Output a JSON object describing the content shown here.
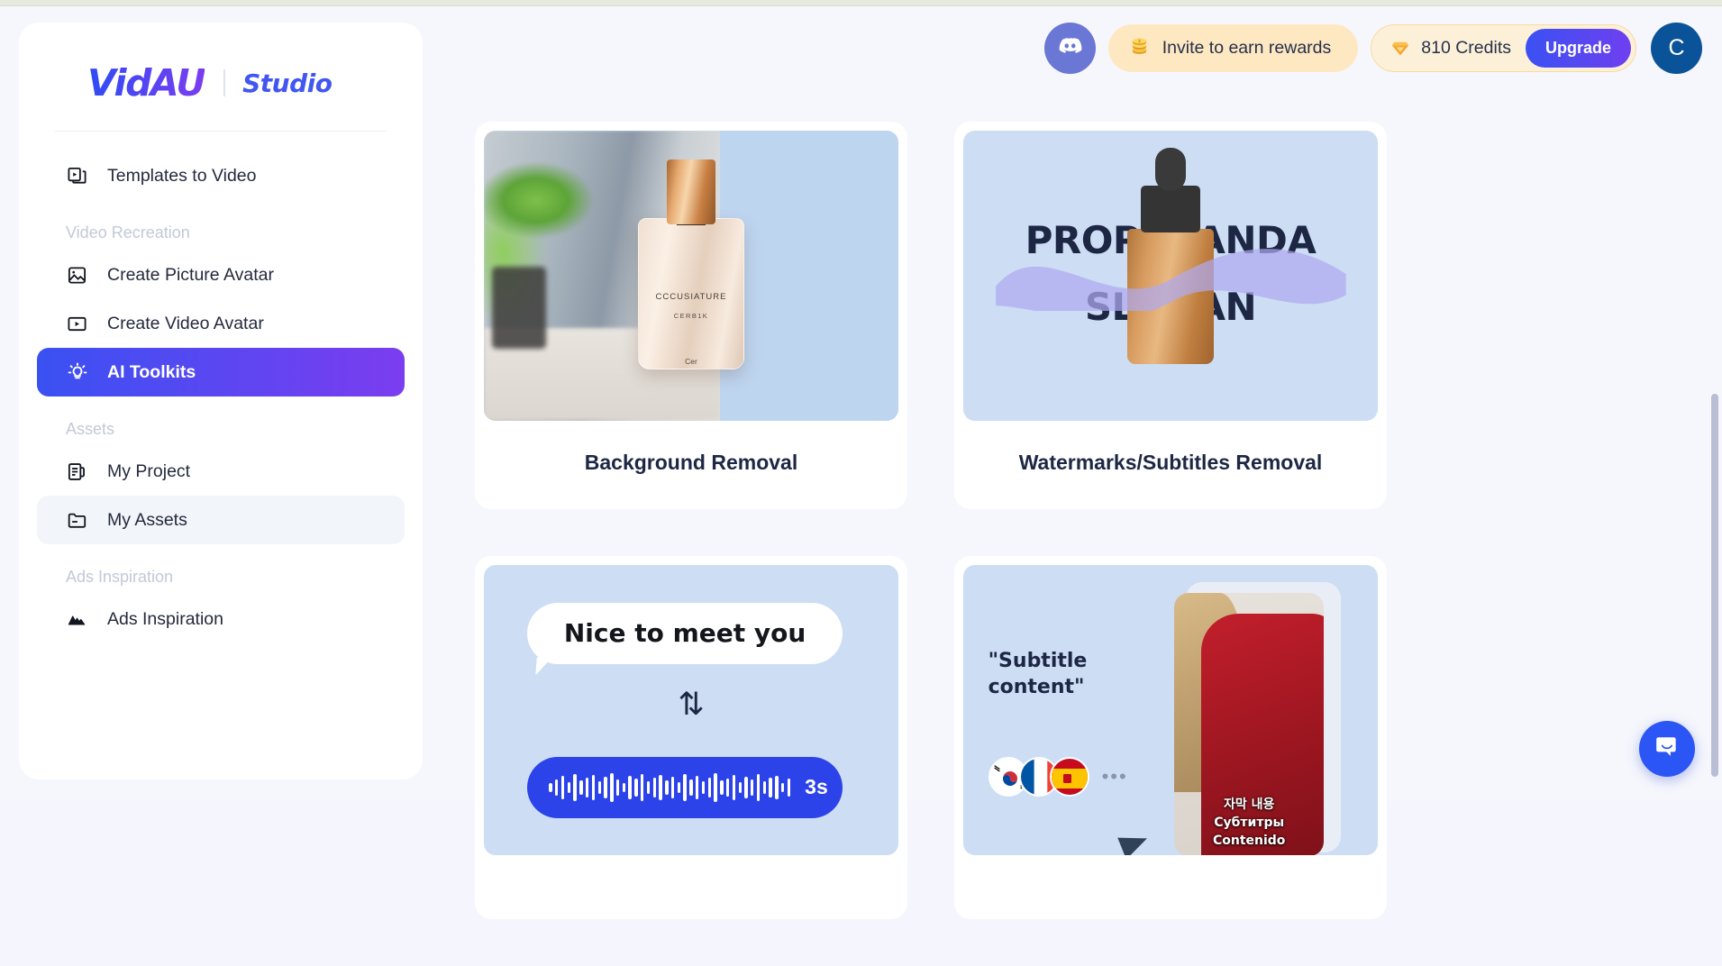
{
  "brand": {
    "logo_primary": "VidAU",
    "logo_secondary": "Studio",
    "accent_blue": "#3a51f2",
    "accent_purple": "#7b3df0"
  },
  "sidebar": {
    "items": [
      {
        "label": "Templates to Video",
        "icon": "templates-video-icon",
        "state": "default"
      }
    ],
    "groups": [
      {
        "title": "Video Recreation",
        "items": [
          {
            "label": "Create Picture Avatar",
            "icon": "picture-avatar-icon",
            "state": "default"
          },
          {
            "label": "Create Video Avatar",
            "icon": "video-avatar-icon",
            "state": "default"
          },
          {
            "label": "AI Toolkits",
            "icon": "lightbulb-icon",
            "state": "active"
          }
        ]
      },
      {
        "title": "Assets",
        "items": [
          {
            "label": "My Project",
            "icon": "project-icon",
            "state": "default"
          },
          {
            "label": "My Assets",
            "icon": "folder-icon",
            "state": "hovered"
          }
        ]
      },
      {
        "title": "Ads Inspiration",
        "items": [
          {
            "label": "Ads Inspiration",
            "icon": "mountain-icon",
            "state": "default"
          }
        ]
      }
    ]
  },
  "header": {
    "discord_icon": "discord-icon",
    "invite": {
      "icon": "coins-icon",
      "label": "Invite to earn rewards"
    },
    "credits": {
      "icon": "gem-icon",
      "label": "810 Credits",
      "amount": "810",
      "upgrade_label": "Upgrade"
    },
    "avatar": {
      "initial": "C",
      "color": "#0a5398"
    }
  },
  "main": {
    "cards": [
      {
        "title": "Background Removal",
        "thumb": {
          "type": "perfume-bottle-split",
          "product_label_1": "CCCUSIATURE",
          "product_label_2": "CERB1K",
          "product_label_3": "Cer"
        }
      },
      {
        "title": "Watermarks/Subtitles Removal",
        "thumb": {
          "type": "watermark-dropper",
          "watermark_line_1": "PROPAGANDA",
          "watermark_line_2": "SLOGAN"
        }
      },
      {
        "title": "",
        "thumb": {
          "type": "text-to-speech",
          "bubble_text": "Nice to meet you",
          "convert_glyph": "⇅",
          "duration": "3s"
        }
      },
      {
        "title": "",
        "thumb": {
          "type": "subtitle-translate",
          "quote": "\"Subtitle content\"",
          "flags": [
            "korea-flag",
            "france-flag",
            "spain-flag"
          ],
          "more_glyph": "•••",
          "subtitle_lines": [
            "자막 내용",
            "Субтитры",
            "Contenido"
          ]
        }
      }
    ]
  },
  "widgets": {
    "chat": {
      "icon": "chat-bubble-icon"
    },
    "scrollbar": {
      "name": "page-scrollbar"
    }
  }
}
